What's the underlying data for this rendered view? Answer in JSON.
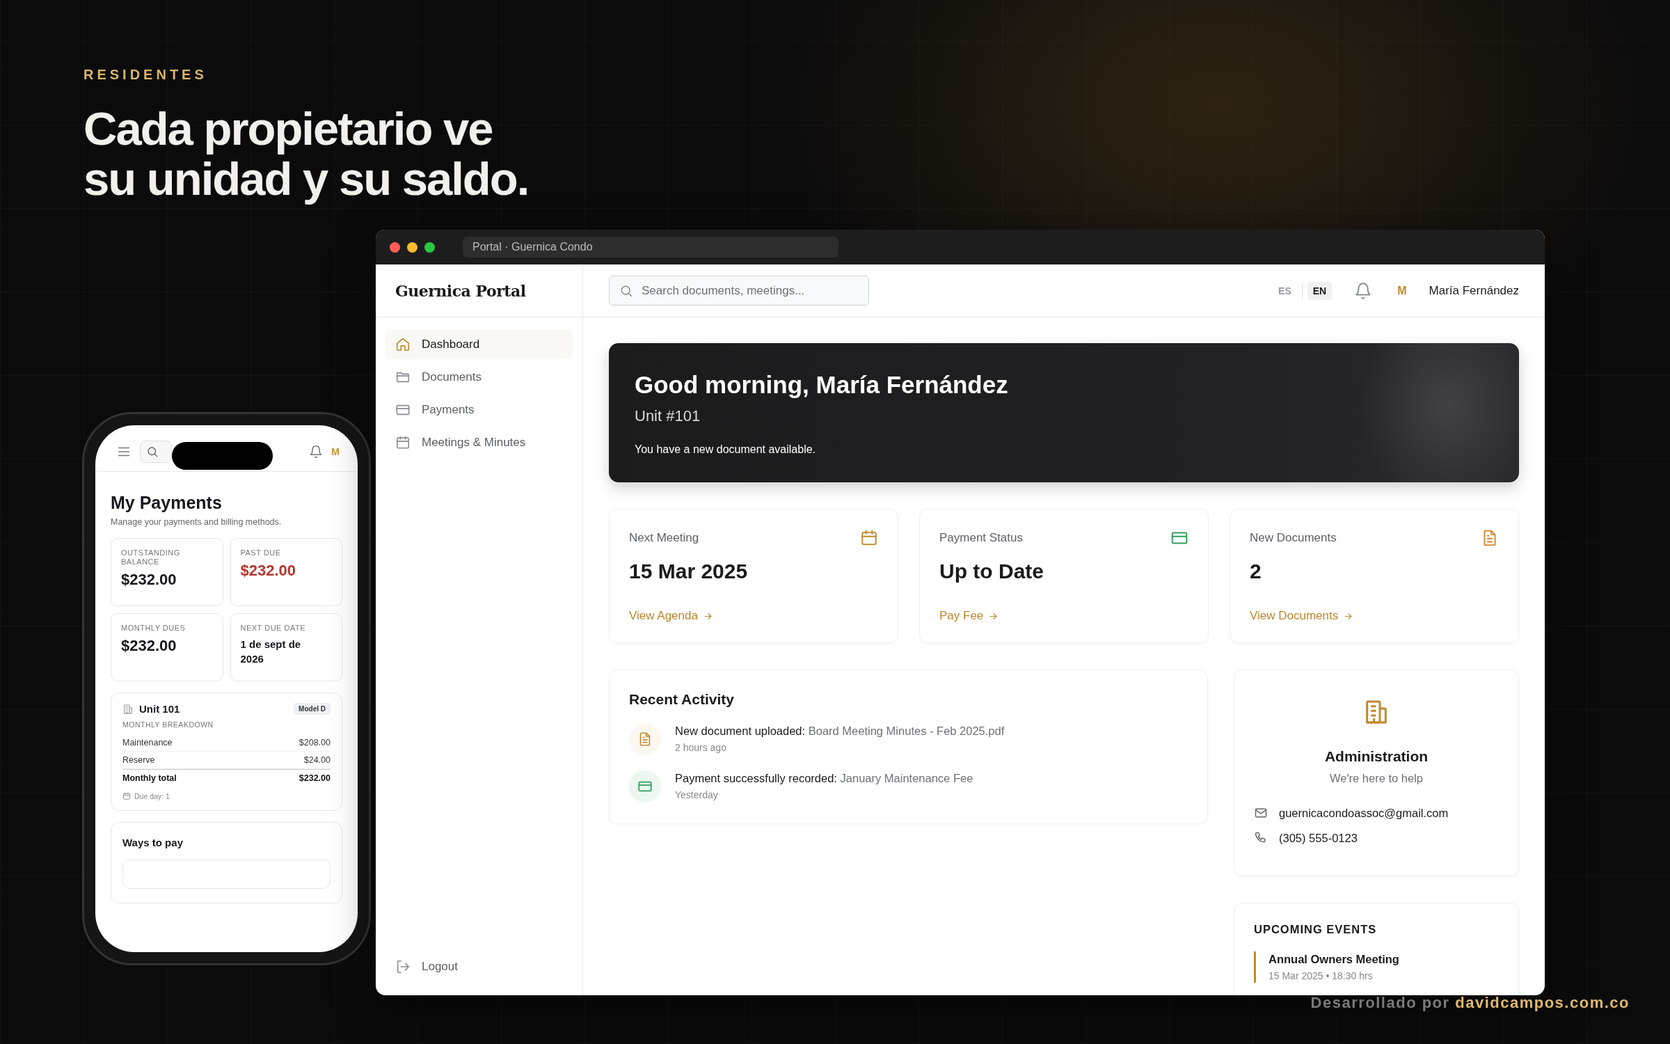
{
  "hero": {
    "eyebrow": "RESIDENTES",
    "headline_lines": [
      "Cada propietario ve",
      "su unidad y su saldo."
    ]
  },
  "phone": {
    "avatar_initial": "M",
    "title": "My Payments",
    "subtitle": "Manage your payments and billing methods.",
    "summary": [
      {
        "label": "OUTSTANDING BALANCE",
        "value": "$232.00",
        "kind": "amount"
      },
      {
        "label": "PAST DUE",
        "value": "$232.00",
        "kind": "alert"
      },
      {
        "label": "MONTHLY DUES",
        "value": "$232.00",
        "kind": "amount"
      },
      {
        "label": "NEXT DUE DATE",
        "value": "1 de sept de 2026",
        "kind": "date"
      }
    ],
    "unit": {
      "name": "Unit 101",
      "badge": "Model D",
      "section": "MONTHLY BREAKDOWN",
      "rows": [
        {
          "label": "Maintenance",
          "amount": "$208.00",
          "kind": "line"
        },
        {
          "label": "Reserve",
          "amount": "$24.00",
          "kind": "line"
        },
        {
          "label": "Monthly total",
          "amount": "$232.00",
          "kind": "total"
        }
      ],
      "due_day": "Due day: 1"
    },
    "ways_to_pay": "Ways to pay"
  },
  "browser": {
    "tab_title": "Portal · Guernica Condo",
    "brand": "Guernica Portal",
    "search": {
      "placeholder": "Search documents, meetings..."
    },
    "languages": [
      {
        "label": "ES",
        "selected": false
      },
      {
        "label": "EN",
        "selected": true
      }
    ],
    "user": {
      "initial": "M",
      "name": "María Fernández"
    },
    "nav": [
      {
        "label": "Dashboard",
        "kind": "home",
        "selected": true
      },
      {
        "label": "Documents",
        "kind": "folder",
        "selected": false
      },
      {
        "label": "Payments",
        "kind": "card",
        "selected": false
      },
      {
        "label": "Meetings & Minutes",
        "kind": "calendar",
        "selected": false
      }
    ],
    "logout": "Logout",
    "banner": {
      "title": "Good morning, María Fernández",
      "unit": "Unit #101",
      "message": "You have a new document available."
    },
    "stats": [
      {
        "label": "Next Meeting",
        "value": "15 Mar 2025",
        "link": "View Agenda",
        "kind": "calendar",
        "color": "#c08a2e"
      },
      {
        "label": "Payment Status",
        "value": "Up to Date",
        "link": "Pay Fee",
        "kind": "card",
        "color": "#2e9e5e"
      },
      {
        "label": "New Documents",
        "value": "2",
        "link": "View Documents",
        "kind": "file",
        "color": "#d98a2b"
      }
    ],
    "recent_activity": {
      "title": "Recent Activity",
      "items": [
        {
          "kind": "document",
          "title": "New document uploaded:",
          "detail": "Board Meeting Minutes - Feb 2025.pdf",
          "time": "2 hours ago"
        },
        {
          "kind": "payment",
          "title": "Payment successfully recorded:",
          "detail": "January Maintenance Fee",
          "time": "Yesterday"
        }
      ]
    },
    "admin": {
      "title": "Administration",
      "subtitle": "We're here to help",
      "email": "guernicacondoassoc@gmail.com",
      "phone": "(305) 555-0123"
    },
    "upcoming_events": {
      "title": "UPCOMING EVENTS",
      "items": [
        {
          "name": "Annual Owners Meeting",
          "date": "15 Mar 2025 • 18:30 hrs"
        }
      ]
    }
  },
  "credit": {
    "label": "Desarrollado por",
    "domain": "davidcampos.com.co"
  }
}
